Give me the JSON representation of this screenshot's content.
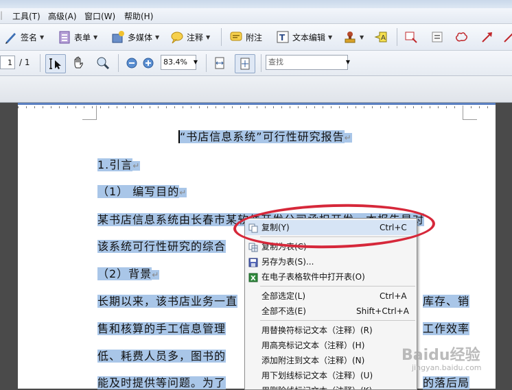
{
  "menubar": {
    "items": [
      "工具(T)",
      "高级(A)",
      "窗口(W)",
      "帮助(H)"
    ]
  },
  "toolbar1": {
    "sign": "签名",
    "forms": "表单",
    "multimedia": "多媒体",
    "comment": "注释",
    "attach": "附注",
    "text_edit": "文本编辑"
  },
  "toolbar2": {
    "page_current": "1",
    "page_total": "/ 1",
    "zoom": "83.4%",
    "find_placeholder": "查找"
  },
  "document": {
    "title": "“书店信息系统”可行性研究报告",
    "lines": [
      "1.引言",
      "（1）  编写目的",
      "某书店信息系统由长春市某软件开发公司承担开发。本报告是对",
      "该系统可行性研究的综合",
      "（2）背景",
      "长期以来，该书店业务一直",
      "售和核算的手工信息管理",
      "低、耗费人员多，图书的",
      "能及时提供等问题。为了"
    ],
    "right_fragments": [
      "库存、销",
      "工作效率",
      "",
      "的落后局"
    ]
  },
  "context_menu": {
    "items": [
      {
        "label": "复制(Y)",
        "shortcut": "Ctrl+C"
      },
      {
        "label": "复制为表(C)",
        "shortcut": ""
      },
      {
        "label": "另存为表(S)...",
        "shortcut": ""
      },
      {
        "label": "在电子表格软件中打开表(O)",
        "shortcut": ""
      },
      {
        "label": "全部选定(L)",
        "shortcut": "Ctrl+A"
      },
      {
        "label": "全部不选(E)",
        "shortcut": "Shift+Ctrl+A"
      },
      {
        "label": "用替换符标记文本（注释）(R)",
        "shortcut": ""
      },
      {
        "label": "用高亮标记文本（注释）(H)",
        "shortcut": ""
      },
      {
        "label": "添加附注到文本（注释）(N)",
        "shortcut": ""
      },
      {
        "label": "用下划线标记文本（注释）(U)",
        "shortcut": ""
      },
      {
        "label": "用删除线标记文本（注释）(K)",
        "shortcut": ""
      }
    ]
  },
  "watermark": {
    "logo": "Baidu经验",
    "url": "jingyan.baidu.com"
  },
  "colors": {
    "highlight": "#a9c6e8",
    "ellipse": "#d6283a"
  }
}
